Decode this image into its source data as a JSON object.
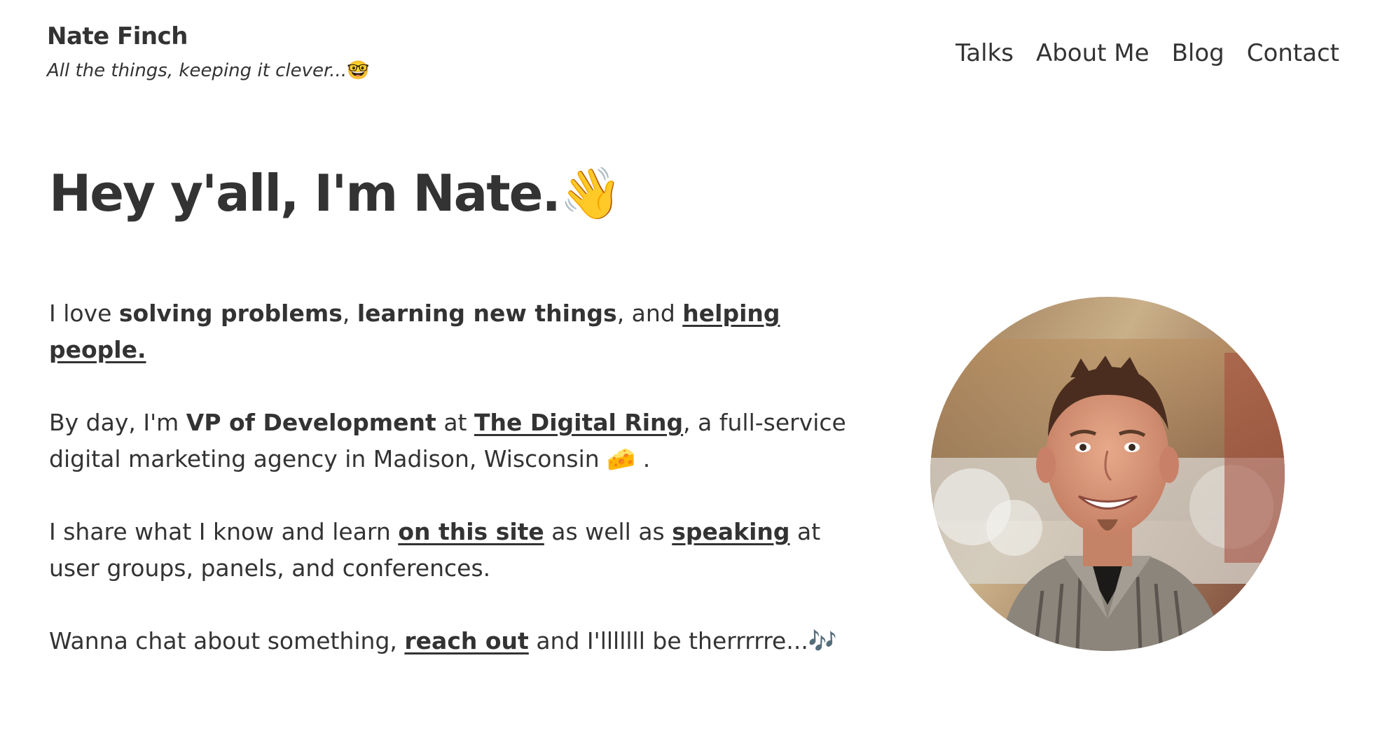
{
  "site": {
    "title": "Nate Finch",
    "tagline": "All the things, keeping it clever...",
    "tagline_emoji": "🤓"
  },
  "nav": {
    "items": [
      {
        "label": "Talks"
      },
      {
        "label": "About Me"
      },
      {
        "label": "Blog"
      },
      {
        "label": "Contact"
      }
    ]
  },
  "hero": {
    "heading": "Hey y'all, I'm Nate.",
    "heading_emoji": "👋"
  },
  "intro": {
    "p1": {
      "t1": "I love ",
      "b1": "solving problems",
      "t2": ", ",
      "b2": "learning new things",
      "t3": ", and ",
      "link": "helping people."
    },
    "p2": {
      "t1": "By day, I'm ",
      "b1": "VP of Development",
      "t2": " at ",
      "link": "The Digital Ring",
      "t3": ", a full-service digital marketing agency in Madison, Wisconsin ",
      "emoji": "🧀",
      "t4": " ."
    },
    "p3": {
      "t1": "I share what I know and learn ",
      "link1": "on this site",
      "t2": " as well as ",
      "link2": "speaking",
      "t3": " at user groups, panels, and conferences."
    },
    "p4": {
      "t1": "Wanna chat about something, ",
      "link": "reach out",
      "t2": " and I'lllllll be therrrrre...",
      "emoji": "🎶"
    }
  },
  "colors": {
    "text": "#333333",
    "background": "#ffffff"
  }
}
